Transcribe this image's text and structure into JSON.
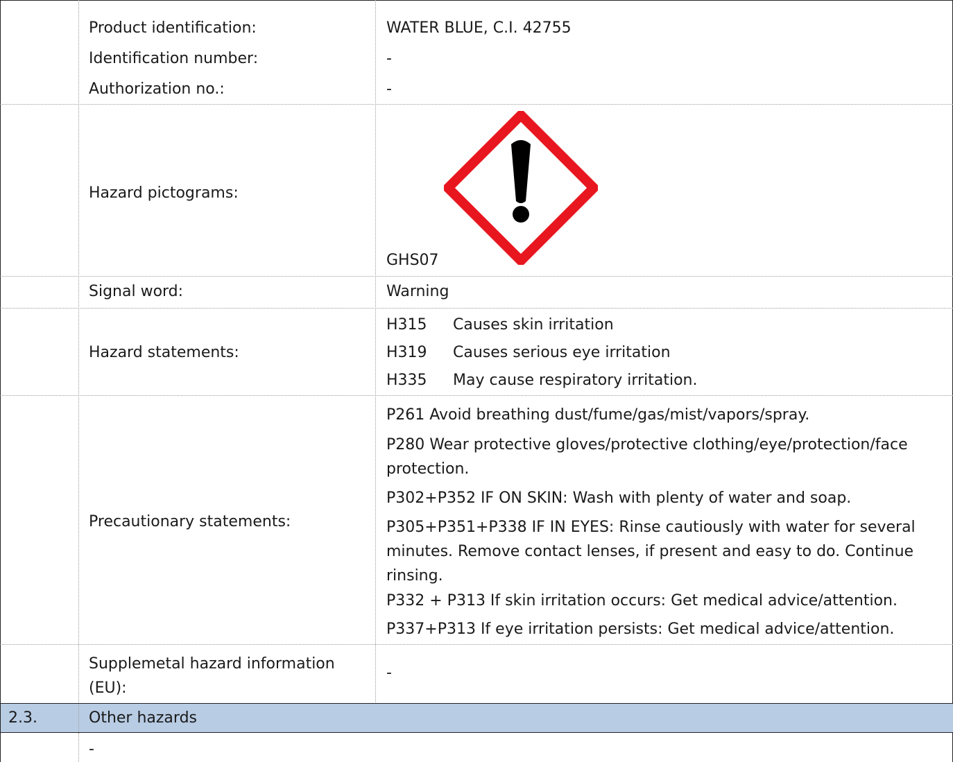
{
  "rows": {
    "product_label": "Product identification:",
    "product_value": "WATER BLUE, C.I. 42755",
    "idnum_label": "Identification number:",
    "idnum_value": "-",
    "auth_label": "Authorization no.:",
    "auth_value": "-",
    "pictograms_label": "Hazard pictograms:",
    "pictogram_code": "GHS07",
    "signal_label": "Signal word:",
    "signal_value": "Warning",
    "hazard_label": "Hazard statements:",
    "hazard_statements": [
      {
        "code": "H315",
        "text": "Causes skin irritation"
      },
      {
        "code": "H319",
        "text": "Causes serious eye irritation"
      },
      {
        "code": "H335",
        "text": "May cause respiratory irritation."
      }
    ],
    "precaution_label": "Precautionary statements:",
    "precautions": [
      "P261 Avoid breathing dust/fume/gas/mist/vapors/spray.",
      "P280 Wear protective gloves/protective clothing/eye/protection/face protection.",
      "P302+P352 IF ON SKIN: Wash with plenty of water and soap.",
      "P305+P351+P338 IF IN EYES: Rinse cautiously with water for several minutes. Remove contact lenses, if present and easy to do. Continue rinsing.",
      "P332 + P313 If skin irritation occurs: Get medical advice/attention.",
      "P337+P313 If eye irritation persists: Get medical advice/attention."
    ],
    "supplemental_label": "Supplemetal hazard information (EU):",
    "supplemental_value": "-"
  },
  "section": {
    "number": "2.3.",
    "title": "Other hazards",
    "content": "-"
  },
  "colors": {
    "section_band": "#b8cce4",
    "pictogram_border": "#e8171f",
    "pictogram_symbol": "#000000"
  },
  "icons": {
    "pictogram": "exclamation-mark-diamond-icon"
  }
}
